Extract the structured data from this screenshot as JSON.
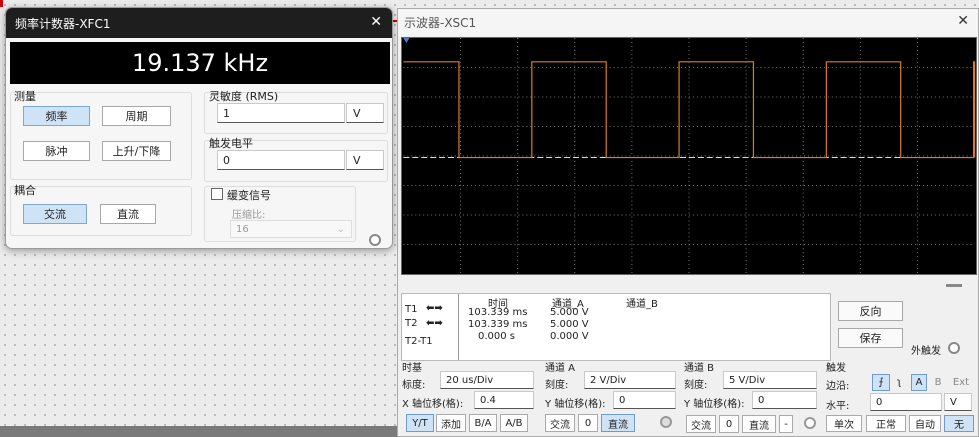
{
  "freq_counter": {
    "title": "频率计数器-XFC1",
    "display_value": "19.137 kHz",
    "measure": {
      "label": "测量",
      "freq": "频率",
      "period": "周期",
      "pulse": "脉冲",
      "rise_fall": "上升/下降"
    },
    "coupling": {
      "label": "耦合",
      "ac": "交流",
      "dc": "直流"
    },
    "sensitivity": {
      "label": "灵敏度 (RMS)",
      "value": "1",
      "unit": "V"
    },
    "trigger": {
      "label": "触发电平",
      "value": "0",
      "unit": "V"
    },
    "slow_signal": {
      "label": "缓变信号",
      "ratio_label": "压缩比:",
      "ratio_value": "16"
    }
  },
  "oscilloscope": {
    "title": "示波器-XSC1",
    "measurements": {
      "rows": [
        "T1",
        "T2",
        "T2-T1"
      ],
      "headers": {
        "time": "时间",
        "ch_a": "通道_A",
        "ch_b": "通道_B"
      },
      "time": [
        "103.339 ms",
        "103.339 ms",
        "0.000 s"
      ],
      "ch_a": [
        "5.000 V",
        "5.000 V",
        "0.000 V"
      ],
      "ch_b": [
        "",
        "",
        ""
      ]
    },
    "reverse_label": "反向",
    "save_label": "保存",
    "ext_trigger_label": "外触发",
    "timebase": {
      "label": "时基",
      "scale_label": "标度:",
      "scale": "20 us/Div",
      "xpos_label": "X 轴位移(格):",
      "xpos": "0.4",
      "yt": "Y/T",
      "add": "添加",
      "ba": "B/A",
      "ab": "A/B"
    },
    "channel_a": {
      "label": "通道 A",
      "scale_label": "刻度:",
      "scale": "2  V/Div",
      "ypos_label": "Y 轴位移(格):",
      "ypos": "0",
      "ac": "交流",
      "zero": "0",
      "dc": "直流"
    },
    "channel_b": {
      "label": "通道 B",
      "scale_label": "刻度:",
      "scale": "5  V/Div",
      "ypos_label": "Y 轴位移(格):",
      "ypos": "0",
      "ac": "交流",
      "zero": "0",
      "dc": "直流",
      "minus": "-"
    },
    "trigger": {
      "label": "触发",
      "edge_label": "边沿:",
      "a": "A",
      "b": "B",
      "ext": "Ext",
      "level_label": "水平:",
      "level": "0",
      "level_unit": "V",
      "single": "单次",
      "normal": "正常",
      "auto": "自动",
      "none": "无"
    },
    "trace_color": "#e07b2a",
    "grid_color": "#777777"
  }
}
